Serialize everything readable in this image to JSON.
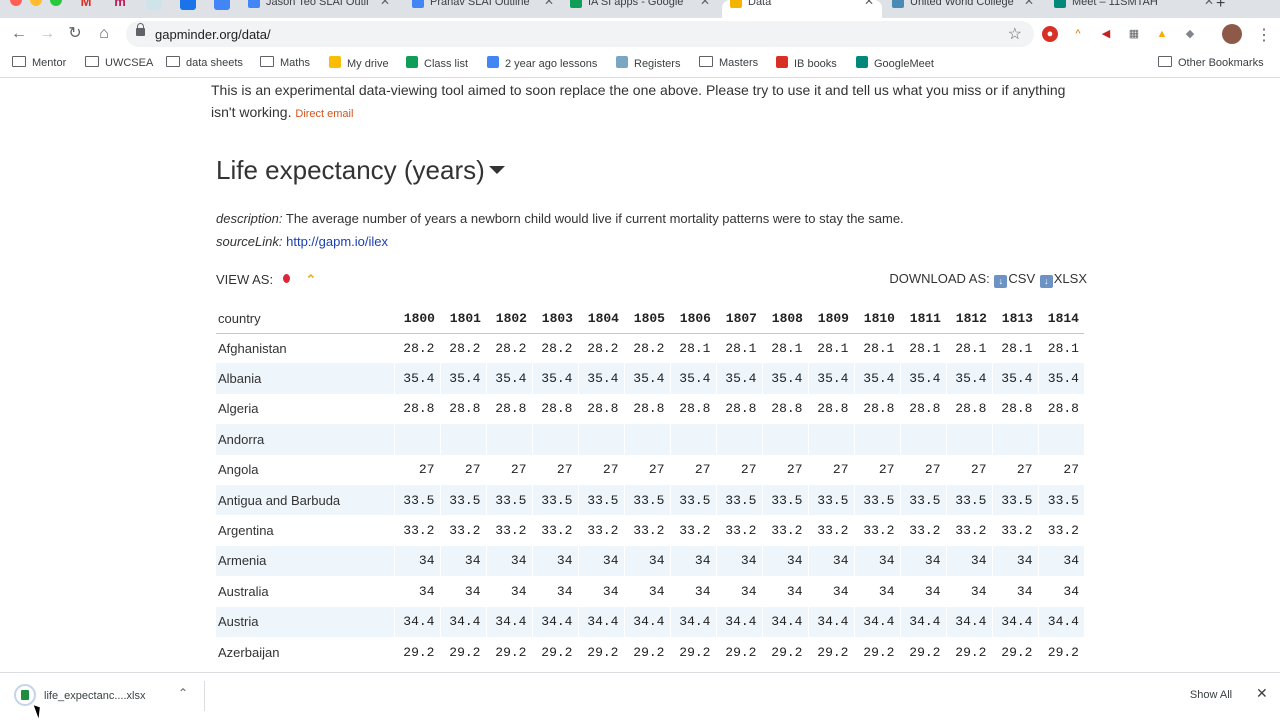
{
  "browser": {
    "tabs": [
      {
        "title": "Jason Teo SLAI Outli",
        "favicon": "docs-icon",
        "color": "#4285f4"
      },
      {
        "title": "Pranav SLAI Outline",
        "favicon": "docs-icon",
        "color": "#4285f4"
      },
      {
        "title": "IA SI apps - Google",
        "favicon": "sheets-icon",
        "color": "#0f9d58"
      },
      {
        "title": "Data",
        "favicon": "gapminder-icon",
        "color": "#f4b400",
        "active": true
      },
      {
        "title": "United World College",
        "favicon": "uwc-icon",
        "color": "#4a8bb5"
      },
      {
        "title": "Meet – 11SMTAH",
        "favicon": "meet-icon",
        "color": "#00897b"
      }
    ],
    "url": "gapminder.org/data/",
    "bookmarks": [
      {
        "label": "Mentor",
        "icon": "folder-icon"
      },
      {
        "label": "UWCSEA",
        "icon": "folder-icon"
      },
      {
        "label": "data sheets",
        "icon": "folder-icon"
      },
      {
        "label": "Maths",
        "icon": "folder-icon"
      },
      {
        "label": "My drive",
        "icon": "drive-icon"
      },
      {
        "label": "Class list",
        "icon": "sheets-icon"
      },
      {
        "label": "2 year ago lessons",
        "icon": "docs-icon"
      },
      {
        "label": "Registers",
        "icon": "registers-icon"
      },
      {
        "label": "Masters",
        "icon": "folder-icon"
      },
      {
        "label": "IB books",
        "icon": "ib-icon"
      },
      {
        "label": "GoogleMeet",
        "icon": "meet-icon"
      }
    ],
    "other_bookmarks": "Other Bookmarks"
  },
  "page": {
    "intro": "This is an experimental data-viewing tool aimed to soon replace the one above. Please try to use it and tell us what you miss or if anything isn't working.",
    "direct_email": "Direct email",
    "title": "Life expectancy (years)",
    "description_label": "description:",
    "description": "The average number of years a newborn child would live if current mortality patterns were to stay the same.",
    "source_label": "sourceLink:",
    "source_link": "http://gapm.io/ilex",
    "view_as": "VIEW AS:",
    "download_as": "DOWNLOAD AS:",
    "csv": "CSV",
    "xlsx": "XLSX"
  },
  "table": {
    "country_header": "country",
    "years": [
      "1800",
      "1801",
      "1802",
      "1803",
      "1804",
      "1805",
      "1806",
      "1807",
      "1808",
      "1809",
      "1810",
      "1811",
      "1812",
      "1813",
      "1814"
    ],
    "rows": [
      {
        "country": "Afghanistan",
        "values": [
          "28.2",
          "28.2",
          "28.2",
          "28.2",
          "28.2",
          "28.2",
          "28.1",
          "28.1",
          "28.1",
          "28.1",
          "28.1",
          "28.1",
          "28.1",
          "28.1",
          "28.1"
        ]
      },
      {
        "country": "Albania",
        "values": [
          "35.4",
          "35.4",
          "35.4",
          "35.4",
          "35.4",
          "35.4",
          "35.4",
          "35.4",
          "35.4",
          "35.4",
          "35.4",
          "35.4",
          "35.4",
          "35.4",
          "35.4"
        ]
      },
      {
        "country": "Algeria",
        "values": [
          "28.8",
          "28.8",
          "28.8",
          "28.8",
          "28.8",
          "28.8",
          "28.8",
          "28.8",
          "28.8",
          "28.8",
          "28.8",
          "28.8",
          "28.8",
          "28.8",
          "28.8"
        ]
      },
      {
        "country": "Andorra",
        "values": [
          "",
          "",
          "",
          "",
          "",
          "",
          "",
          "",
          "",
          "",
          "",
          "",
          "",
          "",
          ""
        ]
      },
      {
        "country": "Angola",
        "values": [
          "27",
          "27",
          "27",
          "27",
          "27",
          "27",
          "27",
          "27",
          "27",
          "27",
          "27",
          "27",
          "27",
          "27",
          "27"
        ]
      },
      {
        "country": "Antigua and Barbuda",
        "values": [
          "33.5",
          "33.5",
          "33.5",
          "33.5",
          "33.5",
          "33.5",
          "33.5",
          "33.5",
          "33.5",
          "33.5",
          "33.5",
          "33.5",
          "33.5",
          "33.5",
          "33.5"
        ]
      },
      {
        "country": "Argentina",
        "values": [
          "33.2",
          "33.2",
          "33.2",
          "33.2",
          "33.2",
          "33.2",
          "33.2",
          "33.2",
          "33.2",
          "33.2",
          "33.2",
          "33.2",
          "33.2",
          "33.2",
          "33.2"
        ]
      },
      {
        "country": "Armenia",
        "values": [
          "34",
          "34",
          "34",
          "34",
          "34",
          "34",
          "34",
          "34",
          "34",
          "34",
          "34",
          "34",
          "34",
          "34",
          "34"
        ]
      },
      {
        "country": "Australia",
        "values": [
          "34",
          "34",
          "34",
          "34",
          "34",
          "34",
          "34",
          "34",
          "34",
          "34",
          "34",
          "34",
          "34",
          "34",
          "34"
        ]
      },
      {
        "country": "Austria",
        "values": [
          "34.4",
          "34.4",
          "34.4",
          "34.4",
          "34.4",
          "34.4",
          "34.4",
          "34.4",
          "34.4",
          "34.4",
          "34.4",
          "34.4",
          "34.4",
          "34.4",
          "34.4"
        ]
      },
      {
        "country": "Azerbaijan",
        "values": [
          "29.2",
          "29.2",
          "29.2",
          "29.2",
          "29.2",
          "29.2",
          "29.2",
          "29.2",
          "29.2",
          "29.2",
          "29.2",
          "29.2",
          "29.2",
          "29.2",
          "29.2"
        ]
      }
    ]
  },
  "download_shelf": {
    "filename": "life_expectanc....xlsx",
    "show_all": "Show All"
  }
}
